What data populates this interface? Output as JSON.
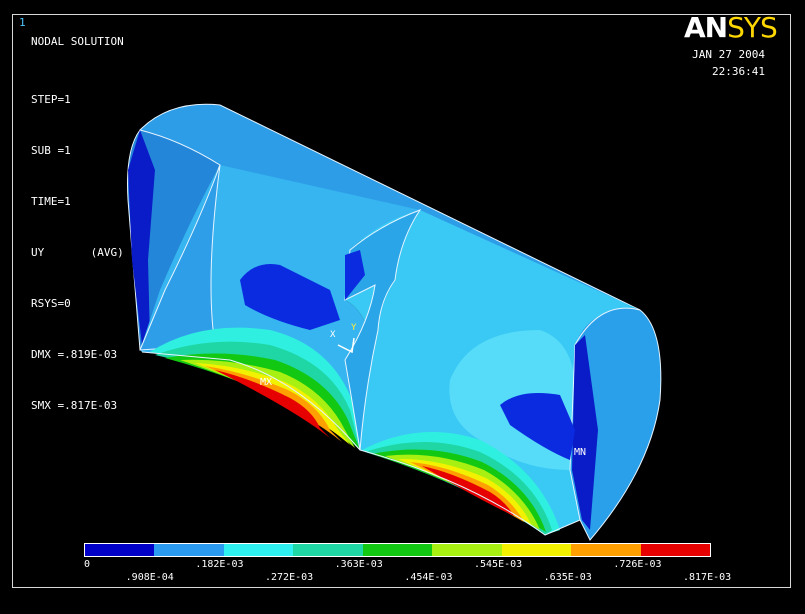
{
  "window_number": "1",
  "logo": {
    "part1": "AN",
    "part2": "SYS"
  },
  "info": {
    "title": "NODAL SOLUTION",
    "lines": [
      "STEP=1",
      "SUB =1",
      "TIME=1",
      "UY       (AVG)",
      "RSYS=0",
      "DMX =.819E-03",
      "SMX =.817E-03"
    ]
  },
  "timestamp": {
    "date": "JAN 27 2004",
    "time": "22:36:41"
  },
  "model_labels": {
    "mx": "MX",
    "mn": "MN",
    "axis_x": "X",
    "axis_y": "Y"
  },
  "legend": {
    "colors": [
      "#0000c8",
      "#2a9bf0",
      "#2ff0f0",
      "#1fd6a5",
      "#12c812",
      "#a8f012",
      "#f2f200",
      "#ffa000",
      "#e60000"
    ],
    "ticks_top": [
      "0",
      ".182E-03",
      ".363E-03",
      ".545E-03",
      ".726E-03"
    ],
    "ticks_bottom": [
      ".908E-04",
      ".272E-03",
      ".454E-03",
      ".635E-03",
      ".817E-03"
    ]
  },
  "colors": {
    "background": "#000000",
    "frame": "#d8d8d8",
    "logo_accent": "#ffd700",
    "window_number": "#4fc3ff"
  }
}
